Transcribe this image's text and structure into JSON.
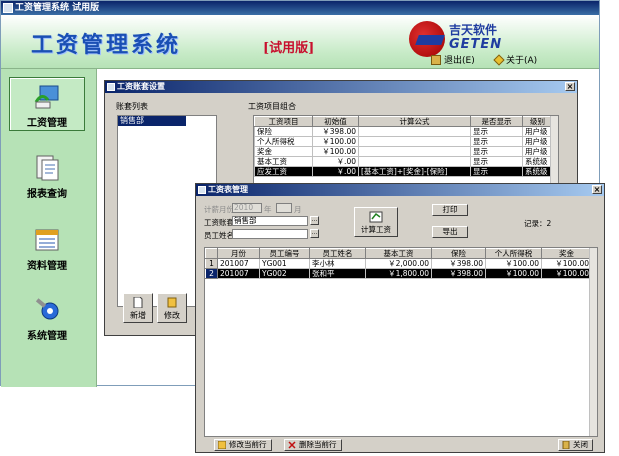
{
  "main_window": {
    "title": "工资管理系统 试用版",
    "banner_title": "工资管理系统",
    "banner_trial": "[试用版]",
    "logo_cn": "吉天软件",
    "logo_en": "GETEN",
    "exit_label": "退出(E)",
    "about_label": "关于(A)"
  },
  "sidebar": {
    "items": [
      {
        "label": "工资管理",
        "icon": "salary-icon"
      },
      {
        "label": "报表查询",
        "icon": "report-icon"
      },
      {
        "label": "资料管理",
        "icon": "data-icon"
      },
      {
        "label": "系统管理",
        "icon": "system-icon"
      }
    ]
  },
  "account_setup": {
    "title": "工资账套设置",
    "list_label": "账套列表",
    "accounts": [
      "销售部"
    ],
    "items_label": "工资项目组合",
    "columns": [
      "工资项目",
      "初始值",
      "计算公式",
      "是否显示",
      "级别"
    ],
    "rows": [
      [
        "保险",
        "￥398.00",
        "",
        "显示",
        "用户级"
      ],
      [
        "个人所得税",
        "￥100.00",
        "",
        "显示",
        "用户级"
      ],
      [
        "奖金",
        "￥100.00",
        "",
        "显示",
        "用户级"
      ],
      [
        "基本工资",
        "￥.00",
        "",
        "显示",
        "系统级"
      ],
      [
        "应发工资",
        "￥.00",
        "[基本工资]+[奖金]-[保险]",
        "显示",
        "系统级"
      ]
    ],
    "new_label": "新增",
    "edit_label": "修改"
  },
  "salary_table": {
    "title": "工资表管理",
    "month_label": "计薪月份",
    "month_value": "2010",
    "month_suffix": "年",
    "month_end": "月",
    "account_label": "工资账套",
    "account_value": "销售部",
    "employee_label": "员工姓名",
    "employee_value": "",
    "calc_label": "计算工资",
    "print_label": "打印",
    "export_label": "导出",
    "records_label": "记录：2",
    "columns": [
      "",
      "月份",
      "员工编号",
      "员工姓名",
      "基本工资",
      "保险",
      "个人所得税",
      "奖金"
    ],
    "rows": [
      [
        "1",
        "201007",
        "YG001",
        "李小林",
        "￥2,000.00",
        "￥398.00",
        "￥100.00",
        "￥100.00"
      ],
      [
        "2",
        "201007",
        "YG002",
        "张和平",
        "￥1,800.00",
        "￥398.00",
        "￥100.00",
        "￥100.00"
      ]
    ],
    "edit_row_label": "修改当前行",
    "delete_row_label": "删除当前行",
    "close_label": "关闭"
  }
}
